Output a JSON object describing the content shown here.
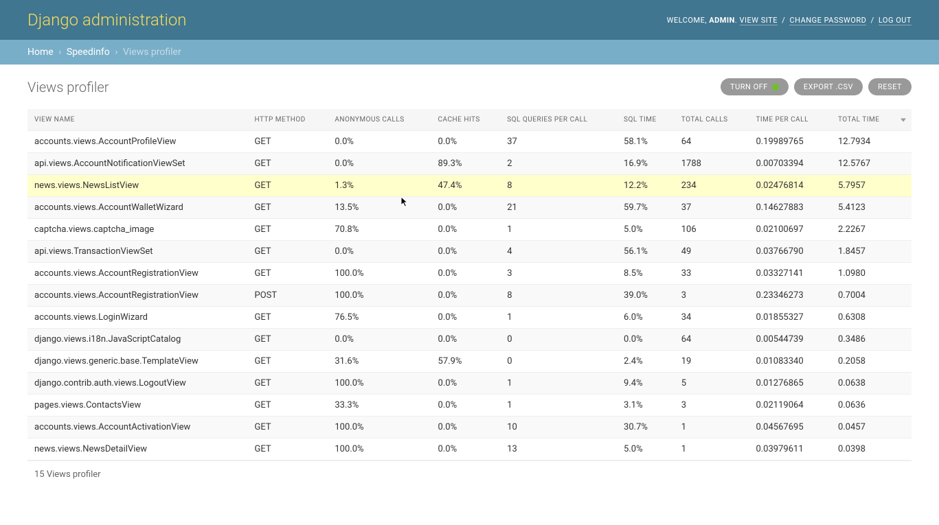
{
  "header": {
    "branding": "Django administration",
    "welcome": "WELCOME,",
    "user": "ADMIN",
    "view_site": "VIEW SITE",
    "change_password": "CHANGE PASSWORD",
    "log_out": "LOG OUT"
  },
  "breadcrumbs": {
    "home": "Home",
    "app": "Speedinfo",
    "current": "Views profiler"
  },
  "page_title": "Views profiler",
  "tools": {
    "turn_off": "TURN OFF",
    "export": "EXPORT .CSV",
    "reset": "RESET"
  },
  "columns": [
    "VIEW NAME",
    "HTTP METHOD",
    "ANONYMOUS CALLS",
    "CACHE HITS",
    "SQL QUERIES PER CALL",
    "SQL TIME",
    "TOTAL CALLS",
    "TIME PER CALL",
    "TOTAL TIME"
  ],
  "rows": [
    {
      "view": "accounts.views.AccountProfileView",
      "method": "GET",
      "anon": "0.0%",
      "cache": "0.0%",
      "sql": "37",
      "sqltime": "58.1%",
      "calls": "64",
      "tpc": "0.19989765",
      "total": "12.7934",
      "hl": false
    },
    {
      "view": "api.views.AccountNotificationViewSet",
      "method": "GET",
      "anon": "0.0%",
      "cache": "89.3%",
      "sql": "2",
      "sqltime": "16.9%",
      "calls": "1788",
      "tpc": "0.00703394",
      "total": "12.5767",
      "hl": false
    },
    {
      "view": "news.views.NewsListView",
      "method": "GET",
      "anon": "1.3%",
      "cache": "47.4%",
      "sql": "8",
      "sqltime": "12.2%",
      "calls": "234",
      "tpc": "0.02476814",
      "total": "5.7957",
      "hl": true
    },
    {
      "view": "accounts.views.AccountWalletWizard",
      "method": "GET",
      "anon": "13.5%",
      "cache": "0.0%",
      "sql": "21",
      "sqltime": "59.7%",
      "calls": "37",
      "tpc": "0.14627883",
      "total": "5.4123",
      "hl": false
    },
    {
      "view": "captcha.views.captcha_image",
      "method": "GET",
      "anon": "70.8%",
      "cache": "0.0%",
      "sql": "1",
      "sqltime": "5.0%",
      "calls": "106",
      "tpc": "0.02100697",
      "total": "2.2267",
      "hl": false
    },
    {
      "view": "api.views.TransactionViewSet",
      "method": "GET",
      "anon": "0.0%",
      "cache": "0.0%",
      "sql": "4",
      "sqltime": "56.1%",
      "calls": "49",
      "tpc": "0.03766790",
      "total": "1.8457",
      "hl": false
    },
    {
      "view": "accounts.views.AccountRegistrationView",
      "method": "GET",
      "anon": "100.0%",
      "cache": "0.0%",
      "sql": "3",
      "sqltime": "8.5%",
      "calls": "33",
      "tpc": "0.03327141",
      "total": "1.0980",
      "hl": false
    },
    {
      "view": "accounts.views.AccountRegistrationView",
      "method": "POST",
      "anon": "100.0%",
      "cache": "0.0%",
      "sql": "8",
      "sqltime": "39.0%",
      "calls": "3",
      "tpc": "0.23346273",
      "total": "0.7004",
      "hl": false
    },
    {
      "view": "accounts.views.LoginWizard",
      "method": "GET",
      "anon": "76.5%",
      "cache": "0.0%",
      "sql": "1",
      "sqltime": "6.0%",
      "calls": "34",
      "tpc": "0.01855327",
      "total": "0.6308",
      "hl": false
    },
    {
      "view": "django.views.i18n.JavaScriptCatalog",
      "method": "GET",
      "anon": "0.0%",
      "cache": "0.0%",
      "sql": "0",
      "sqltime": "0.0%",
      "calls": "64",
      "tpc": "0.00544739",
      "total": "0.3486",
      "hl": false
    },
    {
      "view": "django.views.generic.base.TemplateView",
      "method": "GET",
      "anon": "31.6%",
      "cache": "57.9%",
      "sql": "0",
      "sqltime": "2.4%",
      "calls": "19",
      "tpc": "0.01083340",
      "total": "0.2058",
      "hl": false
    },
    {
      "view": "django.contrib.auth.views.LogoutView",
      "method": "GET",
      "anon": "100.0%",
      "cache": "0.0%",
      "sql": "1",
      "sqltime": "9.4%",
      "calls": "5",
      "tpc": "0.01276865",
      "total": "0.0638",
      "hl": false
    },
    {
      "view": "pages.views.ContactsView",
      "method": "GET",
      "anon": "33.3%",
      "cache": "0.0%",
      "sql": "1",
      "sqltime": "3.1%",
      "calls": "3",
      "tpc": "0.02119064",
      "total": "0.0636",
      "hl": false
    },
    {
      "view": "accounts.views.AccountActivationView",
      "method": "GET",
      "anon": "100.0%",
      "cache": "0.0%",
      "sql": "10",
      "sqltime": "30.7%",
      "calls": "1",
      "tpc": "0.04567695",
      "total": "0.0457",
      "hl": false
    },
    {
      "view": "news.views.NewsDetailView",
      "method": "GET",
      "anon": "100.0%",
      "cache": "0.0%",
      "sql": "13",
      "sqltime": "5.0%",
      "calls": "1",
      "tpc": "0.03979611",
      "total": "0.0398",
      "hl": false
    }
  ],
  "paginator": "15 Views profiler"
}
